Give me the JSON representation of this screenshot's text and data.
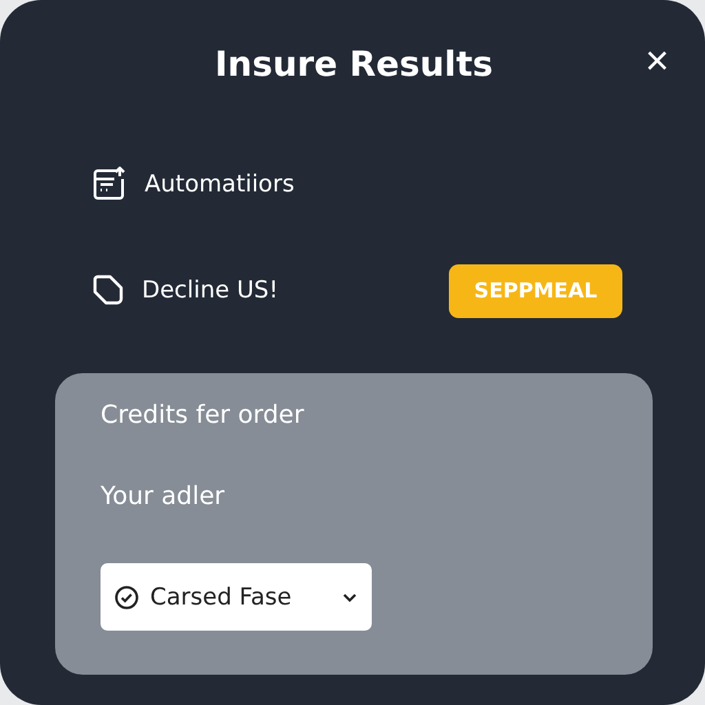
{
  "dialog": {
    "title": "Insure Results",
    "close": "×"
  },
  "rows": [
    {
      "kind": "document",
      "label": "Automatiiors"
    },
    {
      "kind": "tag",
      "label": "Decline US!",
      "button": "SEPPMEAL"
    }
  ],
  "card": {
    "heading": "Credits fer order",
    "subheading": "Your adler",
    "dropdown": {
      "value": "Carsed Fase"
    }
  }
}
